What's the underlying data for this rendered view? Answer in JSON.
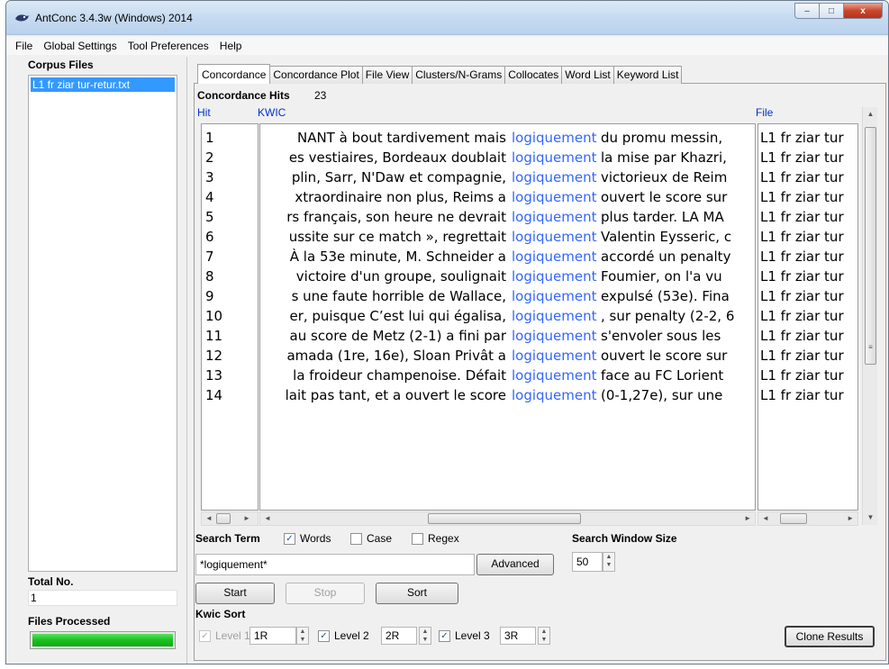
{
  "window": {
    "title": "AntConc 3.4.3w (Windows) 2014",
    "buttons": {
      "minimize": "–",
      "maximize": "□",
      "close": "x"
    }
  },
  "menu": [
    "File",
    "Global Settings",
    "Tool Preferences",
    "Help"
  ],
  "corpus": {
    "label": "Corpus Files",
    "files": [
      "L1 fr ziar tur-retur.txt"
    ],
    "total_label": "Total No.",
    "total_value": "1",
    "processed_label": "Files Processed",
    "progress": 1.0
  },
  "tabs": [
    "Concordance",
    "Concordance Plot",
    "File View",
    "Clusters/N-Grams",
    "Collocates",
    "Word List",
    "Keyword List"
  ],
  "active_tab": "Concordance",
  "concordance": {
    "hits_label": "Concordance Hits",
    "hits_count": "23",
    "col_hit": "Hit",
    "col_kwic": "KWIC",
    "col_file": "File",
    "rows": [
      {
        "hit": "1",
        "left": "NANT à bout tardivement mais",
        "node": "logiquement",
        "right": "du promu messin,",
        "file": "L1 fr ziar tur"
      },
      {
        "hit": "2",
        "left": "es vestiaires, Bordeaux doublait",
        "node": "logiquement",
        "right": "la mise par Khazri,",
        "file": "L1 fr ziar tur"
      },
      {
        "hit": "3",
        "left": "plin, Sarr, N'Daw et compagnie,",
        "node": "logiquement",
        "right": "victorieux de Reim",
        "file": "L1 fr ziar tur"
      },
      {
        "hit": "4",
        "left": "xtraordinaire non plus, Reims a",
        "node": "logiquement",
        "right": "ouvert le score sur",
        "file": "L1 fr ziar tur"
      },
      {
        "hit": "5",
        "left": "rs français, son heure ne devrait",
        "node": "logiquement",
        "right": "plus tarder.  LA MA",
        "file": "L1 fr ziar tur"
      },
      {
        "hit": "6",
        "left": "ussite sur ce match », regrettait",
        "node": "logiquement",
        "right": "Valentin Eysseric, c",
        "file": "L1 fr ziar tur"
      },
      {
        "hit": "7",
        "left": "À la 53e minute, M. Schneider a",
        "node": "logiquement",
        "right": "accordé un penalty",
        "file": "L1 fr ziar tur"
      },
      {
        "hit": "8",
        "left": "victoire d'un groupe, soulignait",
        "node": "logiquement",
        "right": "Foumier, on l'a vu",
        "file": "L1 fr ziar tur"
      },
      {
        "hit": "9",
        "left": "s une faute horrible de Wallace,",
        "node": "logiquement",
        "right": "expulsé (53e). Fina",
        "file": "L1 fr ziar tur"
      },
      {
        "hit": "10",
        "left": "er, puisque C’est lui qui égalisa,",
        "node": "logiquement",
        "right": ", sur penalty (2-2, 6",
        "file": "L1 fr ziar tur"
      },
      {
        "hit": "11",
        "left": "au score de Metz (2-1) a fini par",
        "node": "logiquement",
        "right": "s'envoler sous les",
        "file": "L1 fr ziar tur"
      },
      {
        "hit": "12",
        "left": "amada (1re, 16e), Sloan Privât a",
        "node": "logiquement",
        "right": "ouvert le score sur",
        "file": "L1 fr ziar tur"
      },
      {
        "hit": "13",
        "left": "la froideur champenoise. Défait",
        "node": "logiquement",
        "right": "face au FC Lorient",
        "file": "L1 fr ziar tur"
      },
      {
        "hit": "14",
        "left": "lait pas tant, et a ouvert le score",
        "node": "logiquement",
        "right": "(0-1,27e), sur une",
        "file": "L1 fr ziar tur"
      }
    ]
  },
  "search": {
    "term_label": "Search Term",
    "words_label": "Words",
    "words_checked": true,
    "case_label": "Case",
    "case_checked": false,
    "regex_label": "Regex",
    "regex_checked": false,
    "term_value": "*logiquement*",
    "advanced_label": "Advanced",
    "window_size_label": "Search Window Size",
    "window_size_value": "50",
    "start_label": "Start",
    "stop_label": "Stop",
    "sort_label": "Sort"
  },
  "kwic_sort": {
    "label": "Kwic Sort",
    "level1_label": "Level 1",
    "level1_value": "1R",
    "level1_checked": true,
    "level2_label": "Level 2",
    "level2_value": "2R",
    "level2_checked": true,
    "level3_label": "Level 3",
    "level3_value": "3R",
    "level3_checked": true
  },
  "clone_label": "Clone Results",
  "colors": {
    "node": "#3366ff",
    "selection": "#3399ff",
    "header": "#0033cc",
    "progress": "#1cbf21"
  }
}
